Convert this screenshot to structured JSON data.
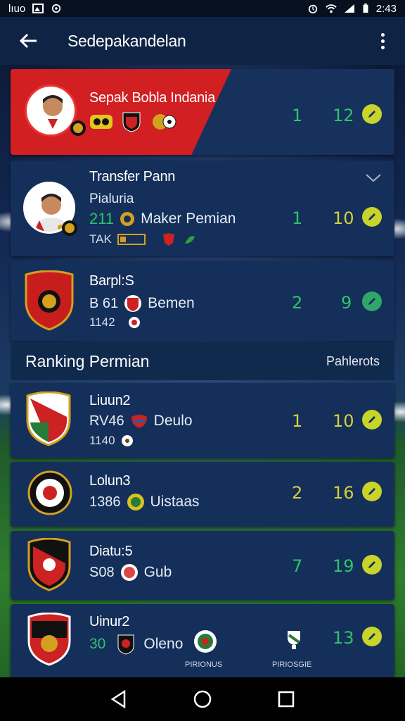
{
  "status_bar": {
    "carrier": "lıuo",
    "time": "2:43"
  },
  "app_bar": {
    "title": "Sedepakandelan"
  },
  "cards": [
    {
      "title": "Sepak Bobla Indania",
      "num1": "1",
      "num2": "12"
    },
    {
      "title": "Transfer Pann",
      "subtitle": "Pialuria",
      "line_value": "211",
      "line_text": "Maker Pemian",
      "meta": "TAK",
      "num1": "1",
      "num2": "10"
    },
    {
      "title": "Barpl:S",
      "line_value": "B 61",
      "line_text": "Bemen",
      "meta": "1142",
      "num1": "2",
      "num2": "9"
    }
  ],
  "section": {
    "title": "Ranking Permian",
    "link": "Pahlerots"
  },
  "rankings": [
    {
      "title": "Liuun2",
      "line_value": "RV46",
      "line_text": "Deulo",
      "meta": "1140",
      "num1": "1",
      "num2": "10"
    },
    {
      "title": "Lolun3",
      "line_value": "1386",
      "line_text": "Uistaas",
      "num1": "2",
      "num2": "16"
    },
    {
      "title": "Diatu:5",
      "line_value": "S08",
      "line_text": "Gub",
      "num1": "7",
      "num2": "19"
    },
    {
      "title": "Uinur2",
      "line_value": "30",
      "line_text": "Oleno",
      "label_a": "PIRIONUS",
      "label_b": "PIRIOSGIE",
      "num2": "13"
    }
  ],
  "colors": {
    "accent_red": "#d11f22",
    "card_bg": "#142f5a",
    "edit_button": "#c8d42a",
    "green_stat": "#2fc36a",
    "yellow_stat": "#d8cf3a"
  },
  "icons": [
    "back-arrow-icon",
    "more-vert-icon",
    "chevron-down-icon",
    "edit-pencil-icon",
    "wifi-icon",
    "signal-icon",
    "battery-icon",
    "nav-back-icon",
    "nav-home-icon",
    "nav-recents-icon"
  ]
}
